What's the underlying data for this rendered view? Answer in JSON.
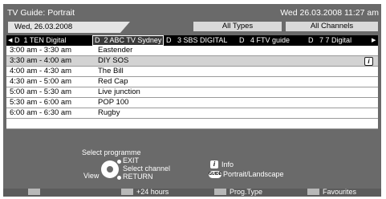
{
  "header": {
    "title": "TV Guide: Portrait",
    "datetime": "Wed 26.03.2008 11:27 am"
  },
  "filters": {
    "date": "Wed, 26.03.2008",
    "types": "All Types",
    "channels": "All Channels"
  },
  "channels": [
    {
      "type": "D",
      "number": "1",
      "name": "TEN Digital",
      "selected": false
    },
    {
      "type": "D",
      "number": "2",
      "name": "ABC TV Sydney",
      "selected": true
    },
    {
      "type": "D",
      "number": "3",
      "name": "SBS DIGITAL",
      "selected": false
    },
    {
      "type": "D",
      "number": "4",
      "name": "FTV guide",
      "selected": false
    },
    {
      "type": "D",
      "number": "7",
      "name": "7 Digital",
      "selected": false
    }
  ],
  "programmes": [
    {
      "time": "3:00 am - 3:30 am",
      "title": "Eastender",
      "selected": false,
      "has_info": false
    },
    {
      "time": "3:30 am - 4:00 am",
      "title": "DIY SOS",
      "selected": true,
      "has_info": true
    },
    {
      "time": "4:00 am - 4:30 am",
      "title": "The Bill",
      "selected": false,
      "has_info": false
    },
    {
      "time": "4:30 am - 5:00 am",
      "title": "Red Cap",
      "selected": false,
      "has_info": false
    },
    {
      "time": "5:00 am - 5:30 am",
      "title": "Live junction",
      "selected": false,
      "has_info": false
    },
    {
      "time": "5:30 am - 6:00 am",
      "title": "POP 100",
      "selected": false,
      "has_info": false
    },
    {
      "time": "6:00 am - 6:30 am",
      "title": "Rugby",
      "selected": false,
      "has_info": false
    },
    {
      "time": "",
      "title": "",
      "selected": false,
      "has_info": false
    }
  ],
  "help": {
    "select_programme": "Select programme",
    "exit": "EXIT",
    "select_channel": "Select channel",
    "return": "RETURN",
    "view": "View",
    "info": "Info",
    "info_glyph": "i",
    "guide_glyph": "GUIDE",
    "portrait_landscape": "Portrait/Landscape"
  },
  "footer": {
    "keys": [
      {
        "label": ""
      },
      {
        "label": "+24 hours"
      },
      {
        "label": "Prog.Type"
      },
      {
        "label": "Favourites"
      }
    ]
  },
  "colors": {
    "frame": "#6a6a6a",
    "selected_row": "#d3d3d3",
    "channel_strip": "#000000"
  }
}
